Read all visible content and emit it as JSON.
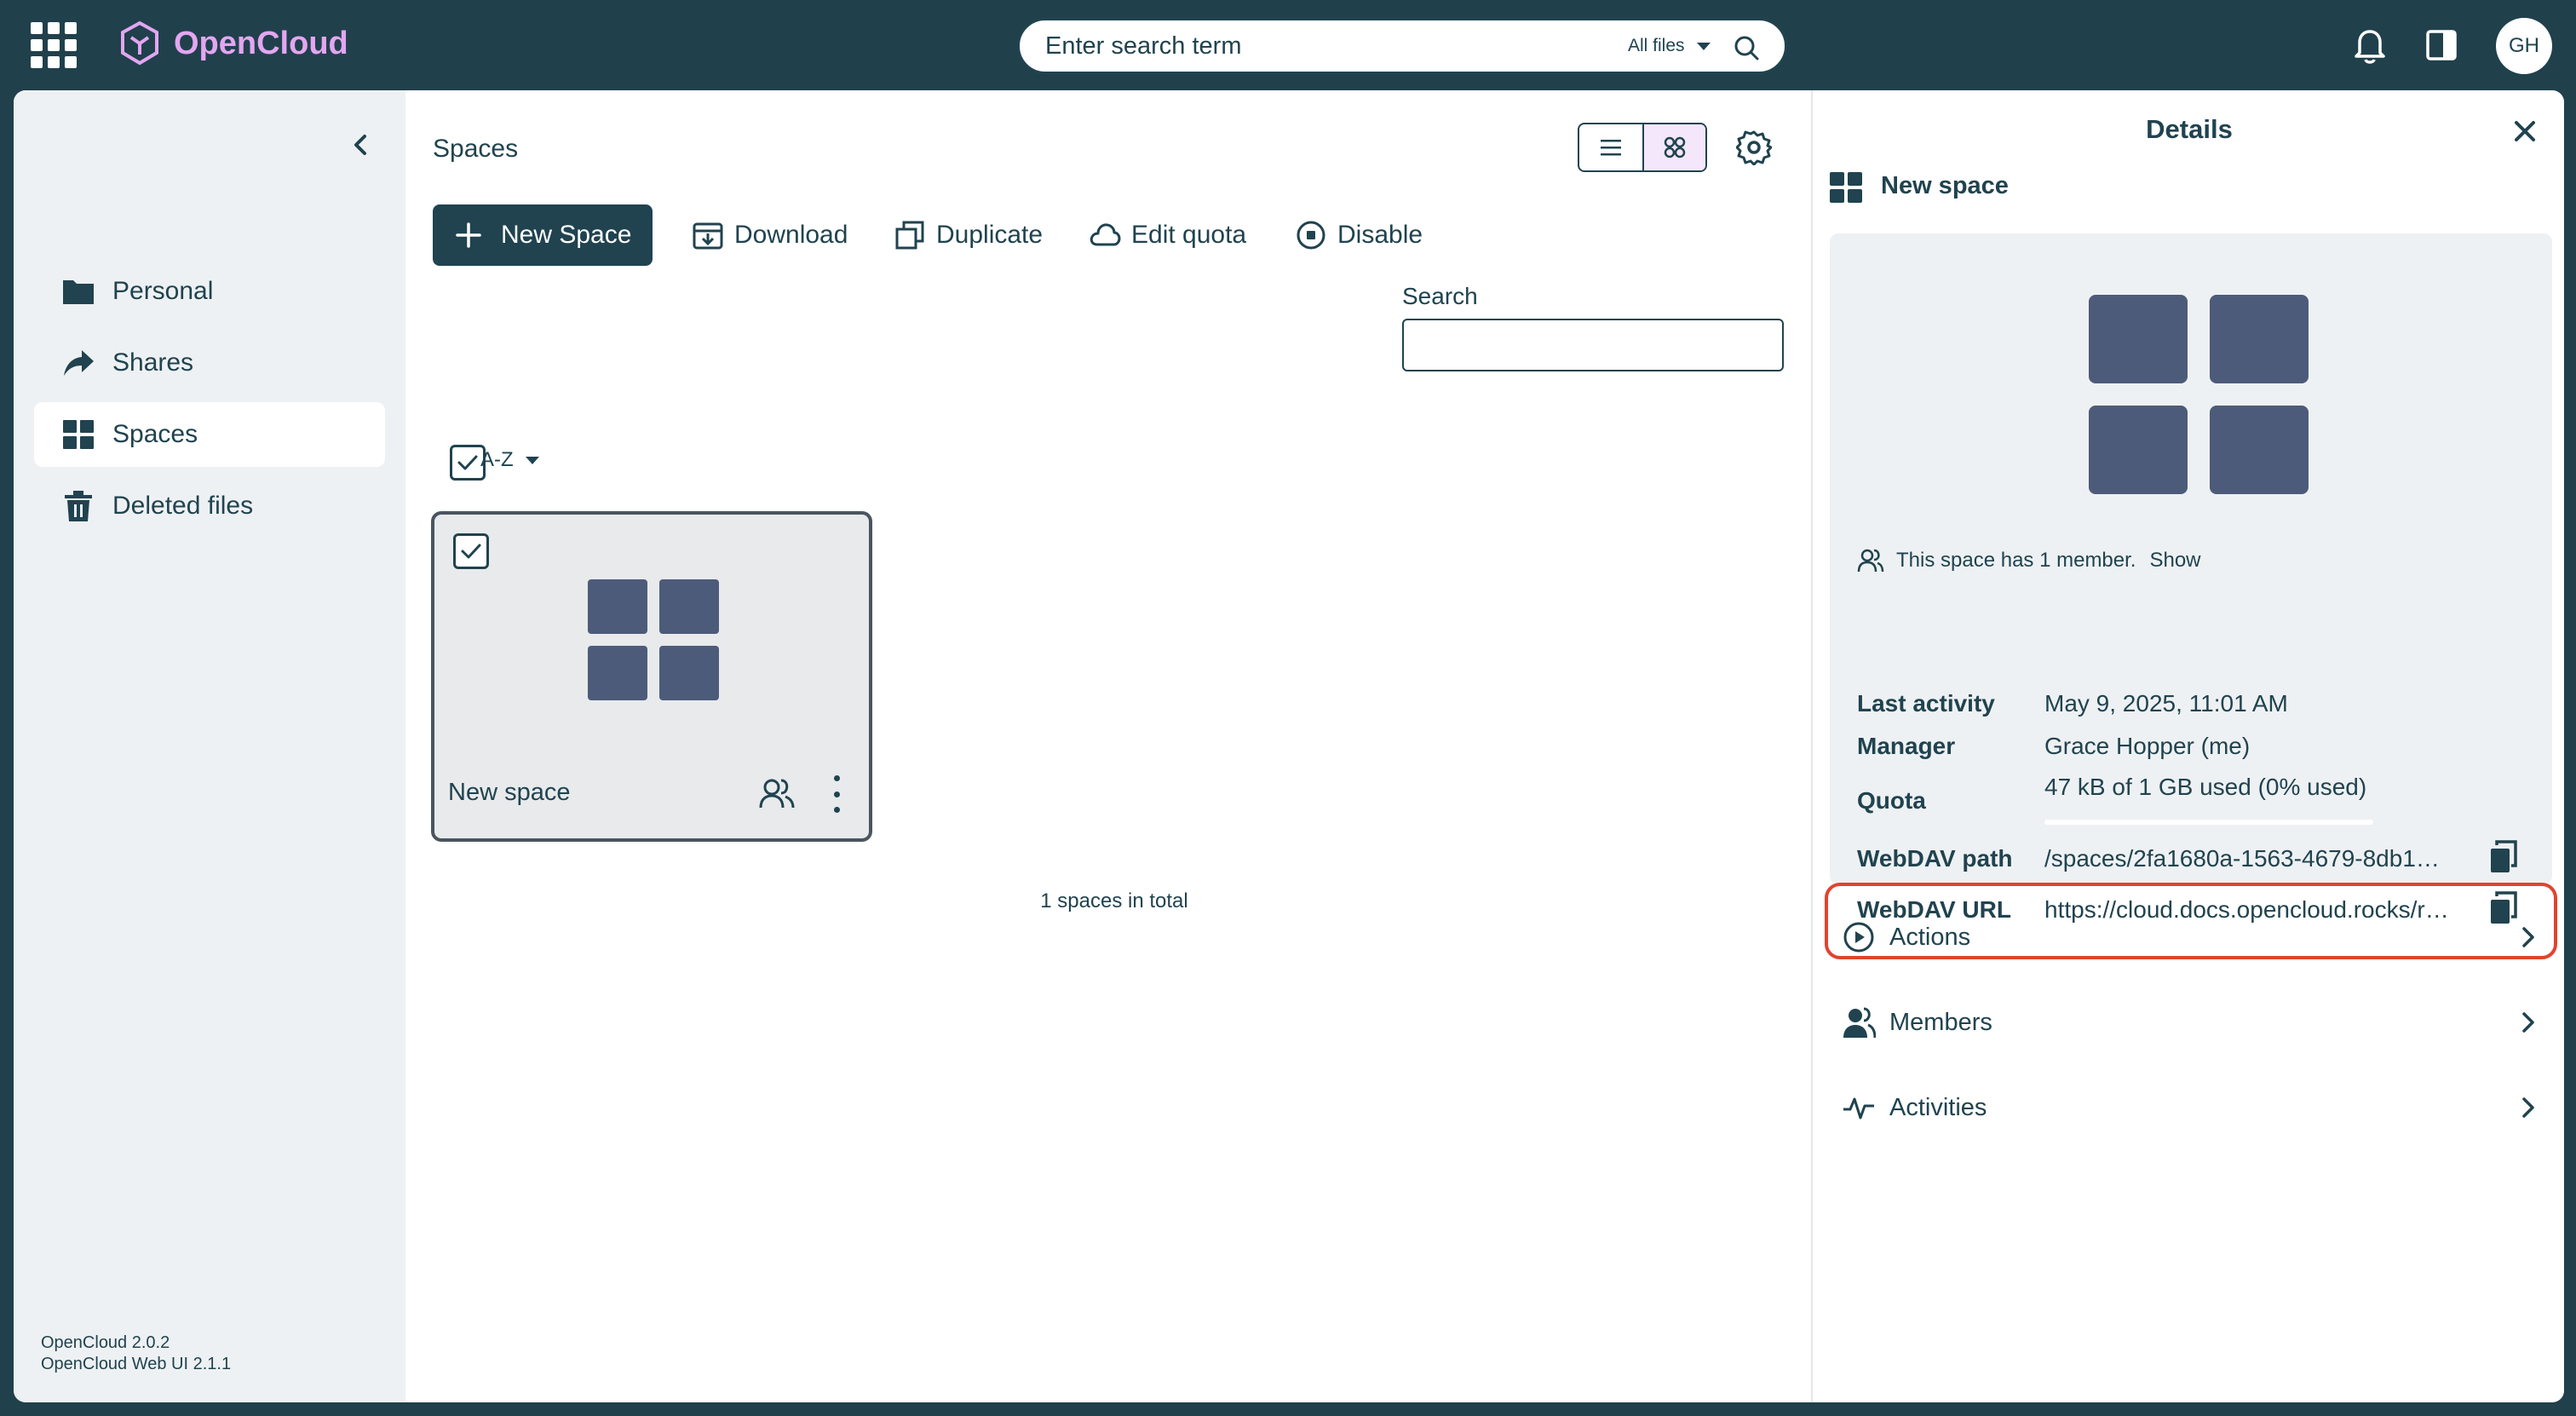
{
  "header": {
    "app_name": "OpenCloud",
    "search_placeholder": "Enter search term",
    "search_scope": "All files",
    "avatar_initials": "GH"
  },
  "sidebar": {
    "items": [
      {
        "label": "Personal",
        "icon": "folder-icon"
      },
      {
        "label": "Shares",
        "icon": "share-arrow-icon"
      },
      {
        "label": "Spaces",
        "icon": "grid-icon"
      },
      {
        "label": "Deleted files",
        "icon": "trash-icon"
      }
    ],
    "active_item": "Spaces",
    "version_line1": "OpenCloud 2.0.2",
    "version_line2": "OpenCloud Web UI 2.1.1"
  },
  "main": {
    "title": "Spaces",
    "new_space_label": "New Space",
    "actions": [
      {
        "label": "Download",
        "icon": "download-icon"
      },
      {
        "label": "Duplicate",
        "icon": "duplicate-icon"
      },
      {
        "label": "Edit quota",
        "icon": "cloud-icon"
      },
      {
        "label": "Disable",
        "icon": "stop-circle-icon"
      }
    ],
    "search_label": "Search",
    "search_value": "",
    "sort_label": "A-Z",
    "view_mode": "tiles",
    "spaces": [
      {
        "name": "New space",
        "selected": true
      }
    ],
    "total_text": "1 spaces in total"
  },
  "details": {
    "title": "Details",
    "space_name": "New space",
    "member_text": "This space has 1 member.",
    "member_show": "Show",
    "fields": {
      "last_activity_label": "Last activity",
      "last_activity": "May 9, 2025, 11:01 AM",
      "manager_label": "Manager",
      "manager": "Grace Hopper (me)",
      "quota_label": "Quota",
      "quota": "47 kB of 1 GB used (0% used)",
      "quota_fraction": 0.0,
      "webdav_path_label": "WebDAV path",
      "webdav_path": "/spaces/2fa1680a-1563-4679-8db1…",
      "webdav_url_label": "WebDAV URL",
      "webdav_url": "https://cloud.docs.opencloud.rocks/r…"
    },
    "accordions": [
      {
        "label": "Actions",
        "icon": "play-circle-icon"
      },
      {
        "label": "Members",
        "icon": "members-icon"
      },
      {
        "label": "Activities",
        "icon": "activity-icon"
      }
    ]
  },
  "colors": {
    "header_bg": "#20404c",
    "text_primary": "#20434f",
    "brand_logo": "#e3a6f0",
    "tile_fill": "#4d5b7a",
    "highlight_border": "#e0442f",
    "sidebar_bg": "#eef1f3"
  }
}
